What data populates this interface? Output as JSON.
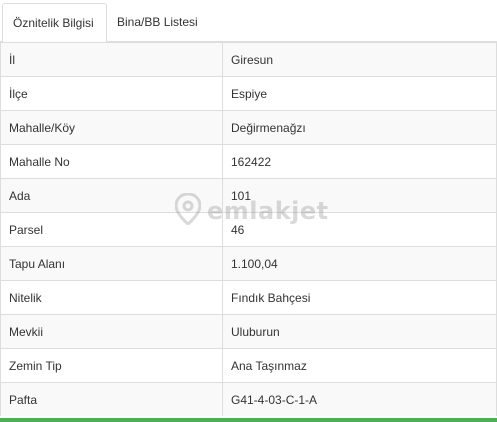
{
  "tabs": [
    {
      "label": "Öznitelik Bilgisi"
    },
    {
      "label": "Bina/BB Listesi"
    }
  ],
  "rows": [
    {
      "key": "İl",
      "value": "Giresun"
    },
    {
      "key": "İlçe",
      "value": "Espiye"
    },
    {
      "key": "Mahalle/Köy",
      "value": "Değirmenağzı"
    },
    {
      "key": "Mahalle No",
      "value": "162422"
    },
    {
      "key": "Ada",
      "value": "101"
    },
    {
      "key": "Parsel",
      "value": "46"
    },
    {
      "key": "Tapu Alanı",
      "value": "1.100,04"
    },
    {
      "key": "Nitelik",
      "value": "Fındık Bahçesi"
    },
    {
      "key": "Mevkii",
      "value": "Uluburun"
    },
    {
      "key": "Zemin Tip",
      "value": "Ana Taşınmaz"
    },
    {
      "key": "Pafta",
      "value": "G41-4-03-C-1-A"
    }
  ],
  "watermark": {
    "text": "emlakjet",
    "icon": "location-pin-icon"
  },
  "colors": {
    "accent_bar": "#4caf50",
    "border": "#dddddd",
    "stripe": "#f9f9f9"
  }
}
